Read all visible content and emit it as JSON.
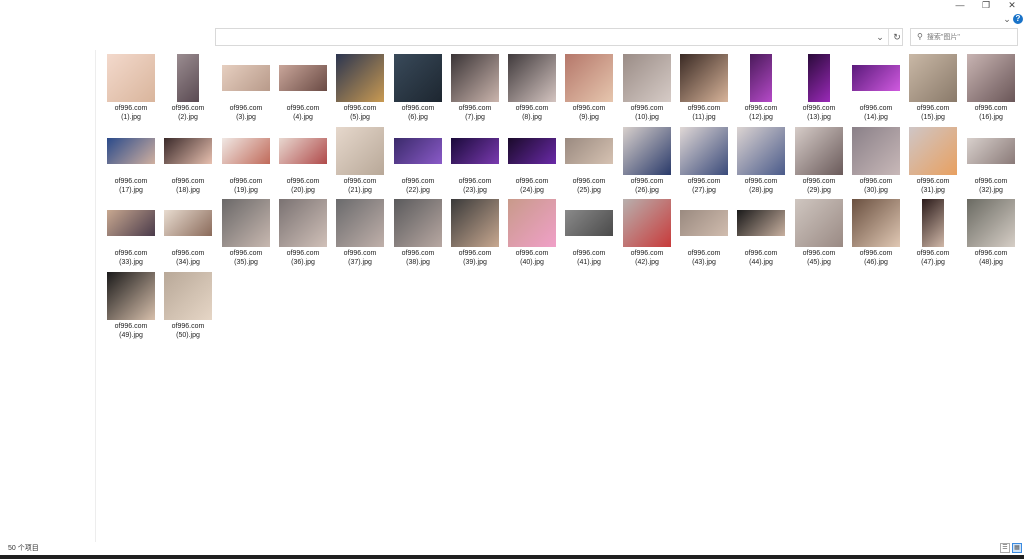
{
  "window": {
    "minimize": "—",
    "maximize": "❐",
    "close": "✕"
  },
  "toolbar": {
    "collapse": "⌄",
    "help": "?"
  },
  "address": {
    "dropdown": "⌄",
    "refresh": "↻"
  },
  "search": {
    "placeholder": "搜索\"图片\""
  },
  "status": {
    "item_count": "50 个项目"
  },
  "files": [
    {
      "line1": "of996.com",
      "line2": "(1).jpg",
      "c1": "#f3d9cc",
      "c2": "#d9b59c",
      "shape": "sq"
    },
    {
      "line1": "of996.com",
      "line2": "(2).jpg",
      "c1": "#9a8c90",
      "c2": "#5a4a52",
      "shape": "tall"
    },
    {
      "line1": "of996.com",
      "line2": "(3).jpg",
      "c1": "#e6cfc0",
      "c2": "#b89a8a",
      "shape": "wide"
    },
    {
      "line1": "of996.com",
      "line2": "(4).jpg",
      "c1": "#c9a69a",
      "c2": "#6a4a44",
      "shape": "wide"
    },
    {
      "line1": "of996.com",
      "line2": "(5).jpg",
      "c1": "#2b3550",
      "c2": "#c99a52",
      "shape": "sq"
    },
    {
      "line1": "of996.com",
      "line2": "(6).jpg",
      "c1": "#394a5a",
      "c2": "#1d2630",
      "shape": "sq"
    },
    {
      "line1": "of996.com",
      "line2": "(7).jpg",
      "c1": "#3a3436",
      "c2": "#cbb5ad",
      "shape": "sq"
    },
    {
      "line1": "of996.com",
      "line2": "(8).jpg",
      "c1": "#403a3c",
      "c2": "#d4c4c0",
      "shape": "sq"
    },
    {
      "line1": "of996.com",
      "line2": "(9).jpg",
      "c1": "#b5776a",
      "c2": "#e6c6ae",
      "shape": "sq"
    },
    {
      "line1": "of996.com",
      "line2": "(10).jpg",
      "c1": "#9a8c86",
      "c2": "#d6cbc6",
      "shape": "sq"
    },
    {
      "line1": "of996.com",
      "line2": "(11).jpg",
      "c1": "#3a2a24",
      "c2": "#d8b49a",
      "shape": "sq"
    },
    {
      "line1": "of996.com",
      "line2": "(12).jpg",
      "c1": "#4a1a5a",
      "c2": "#b54ac8",
      "shape": "tall"
    },
    {
      "line1": "of996.com",
      "line2": "(13).jpg",
      "c1": "#2a0a3a",
      "c2": "#9a2ab8",
      "shape": "tall"
    },
    {
      "line1": "of996.com",
      "line2": "(14).jpg",
      "c1": "#5a1a7a",
      "c2": "#d05ae0",
      "shape": "wide"
    },
    {
      "line1": "of996.com",
      "line2": "(15).jpg",
      "c1": "#c9b8a6",
      "c2": "#8a7a6a",
      "shape": "sq"
    },
    {
      "line1": "of996.com",
      "line2": "(16).jpg",
      "c1": "#c8b4b2",
      "c2": "#6a5658",
      "shape": "sq"
    },
    {
      "line1": "of996.com",
      "line2": "(17).jpg",
      "c1": "#2a4a8a",
      "c2": "#d0b0a0",
      "shape": "wide"
    },
    {
      "line1": "of996.com",
      "line2": "(18).jpg",
      "c1": "#3a2a2a",
      "c2": "#e8c0b0",
      "shape": "wide"
    },
    {
      "line1": "of996.com",
      "line2": "(19).jpg",
      "c1": "#f0e8e4",
      "c2": "#c06a5a",
      "shape": "wide"
    },
    {
      "line1": "of996.com",
      "line2": "(20).jpg",
      "c1": "#e8d8d0",
      "c2": "#b04a4a",
      "shape": "wide"
    },
    {
      "line1": "of996.com",
      "line2": "(21).jpg",
      "c1": "#e6d8cc",
      "c2": "#b8a898",
      "shape": "sq"
    },
    {
      "line1": "of996.com",
      "line2": "(22).jpg",
      "c1": "#3a2a6a",
      "c2": "#8a5ac8",
      "shape": "wide"
    },
    {
      "line1": "of996.com",
      "line2": "(23).jpg",
      "c1": "#1a0a3a",
      "c2": "#7a3ab0",
      "shape": "wide"
    },
    {
      "line1": "of996.com",
      "line2": "(24).jpg",
      "c1": "#1a0a2a",
      "c2": "#6a2aa8",
      "shape": "wide"
    },
    {
      "line1": "of996.com",
      "line2": "(25).jpg",
      "c1": "#9a8a80",
      "c2": "#d6c2b2",
      "shape": "wide"
    },
    {
      "line1": "of996.com",
      "line2": "(26).jpg",
      "c1": "#d8d0cc",
      "c2": "#2a3a6a",
      "shape": "sq"
    },
    {
      "line1": "of996.com",
      "line2": "(27).jpg",
      "c1": "#e0d8d6",
      "c2": "#3a4a7a",
      "shape": "sq"
    },
    {
      "line1": "of996.com",
      "line2": "(28).jpg",
      "c1": "#dcd4d2",
      "c2": "#4a5a8a",
      "shape": "sq"
    },
    {
      "line1": "of996.com",
      "line2": "(29).jpg",
      "c1": "#d6ccc8",
      "c2": "#6a5a5a",
      "shape": "sq"
    },
    {
      "line1": "of996.com",
      "line2": "(30).jpg",
      "c1": "#8a8088",
      "c2": "#c8b8b8",
      "shape": "sq"
    },
    {
      "line1": "of996.com",
      "line2": "(31).jpg",
      "c1": "#cfc6c6",
      "c2": "#e8a060",
      "shape": "sq"
    },
    {
      "line1": "of996.com",
      "line2": "(32).jpg",
      "c1": "#d8d0cc",
      "c2": "#8a7a78",
      "shape": "wide"
    },
    {
      "line1": "of996.com",
      "line2": "(33).jpg",
      "c1": "#c8a890",
      "c2": "#4a3a4a",
      "shape": "wide"
    },
    {
      "line1": "of996.com",
      "line2": "(34).jpg",
      "c1": "#e8dcd0",
      "c2": "#8a6a5a",
      "shape": "wide"
    },
    {
      "line1": "of996.com",
      "line2": "(35).jpg",
      "c1": "#6a6868",
      "c2": "#c8b8b0",
      "shape": "sq"
    },
    {
      "line1": "of996.com",
      "line2": "(36).jpg",
      "c1": "#7a7272",
      "c2": "#d0c0b8",
      "shape": "sq"
    },
    {
      "line1": "of996.com",
      "line2": "(37).jpg",
      "c1": "#6a6a6c",
      "c2": "#c0b0aa",
      "shape": "sq"
    },
    {
      "line1": "of996.com",
      "line2": "(38).jpg",
      "c1": "#5a5a5c",
      "c2": "#b8a8a2",
      "shape": "sq"
    },
    {
      "line1": "of996.com",
      "line2": "(39).jpg",
      "c1": "#3a3a3a",
      "c2": "#c8a890",
      "shape": "sq"
    },
    {
      "line1": "of996.com",
      "line2": "(40).jpg",
      "c1": "#c89a8a",
      "c2": "#f0a0c8",
      "shape": "sq"
    },
    {
      "line1": "of996.com",
      "line2": "(41).jpg",
      "c1": "#8a8a8a",
      "c2": "#4a4a4a",
      "shape": "wide"
    },
    {
      "line1": "of996.com",
      "line2": "(42).jpg",
      "c1": "#b8b0ae",
      "c2": "#c83a3a",
      "shape": "sq"
    },
    {
      "line1": "of996.com",
      "line2": "(43).jpg",
      "c1": "#9a8a80",
      "c2": "#d0bcae",
      "shape": "wide"
    },
    {
      "line1": "of996.com",
      "line2": "(44).jpg",
      "c1": "#1a1a1a",
      "c2": "#c8b0a0",
      "shape": "wide"
    },
    {
      "line1": "of996.com",
      "line2": "(45).jpg",
      "c1": "#cfc6c0",
      "c2": "#9a8a84",
      "shape": "sq"
    },
    {
      "line1": "of996.com",
      "line2": "(46).jpg",
      "c1": "#6a5040",
      "c2": "#e0c8b4",
      "shape": "sq"
    },
    {
      "line1": "of996.com",
      "line2": "(47).jpg",
      "c1": "#2a1a1a",
      "c2": "#d0b8a8",
      "shape": "tall"
    },
    {
      "line1": "of996.com",
      "line2": "(48).jpg",
      "c1": "#6a6a62",
      "c2": "#d6cec6",
      "shape": "sq"
    },
    {
      "line1": "of996.com",
      "line2": "(49).jpg",
      "c1": "#1a1a1a",
      "c2": "#d8c0ac",
      "shape": "sq"
    },
    {
      "line1": "of996.com",
      "line2": "(50).jpg",
      "c1": "#b8a898",
      "c2": "#e6d6c6",
      "shape": "sq"
    }
  ]
}
